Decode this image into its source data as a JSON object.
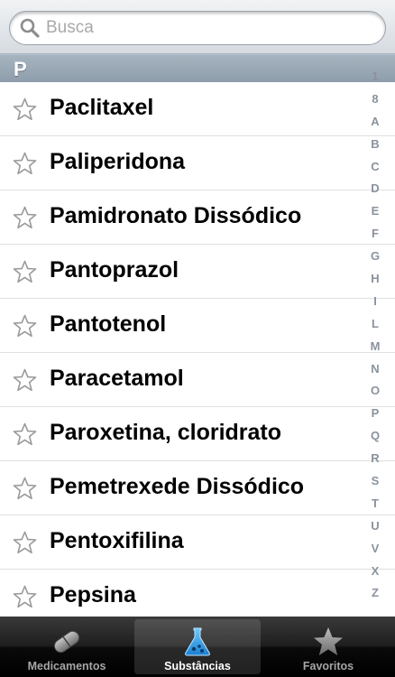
{
  "search": {
    "placeholder": "Busca",
    "icon": "search-icon"
  },
  "section": {
    "letter": "P"
  },
  "items": [
    {
      "label": "Paclitaxel",
      "icon": "star-outline-icon"
    },
    {
      "label": "Paliperidona",
      "icon": "star-outline-icon"
    },
    {
      "label": "Pamidronato Dissódico",
      "icon": "star-outline-icon"
    },
    {
      "label": "Pantoprazol",
      "icon": "star-outline-icon"
    },
    {
      "label": "Pantotenol",
      "icon": "star-outline-icon"
    },
    {
      "label": "Paracetamol",
      "icon": "star-outline-icon"
    },
    {
      "label": "Paroxetina, cloridrato",
      "icon": "star-outline-icon"
    },
    {
      "label": "Pemetrexede Dissódico",
      "icon": "star-outline-icon"
    },
    {
      "label": "Pentoxifilina",
      "icon": "star-outline-icon"
    },
    {
      "label": "Pepsina",
      "icon": "star-outline-icon"
    }
  ],
  "index": [
    "1",
    "8",
    "A",
    "B",
    "C",
    "D",
    "E",
    "F",
    "G",
    "H",
    "I",
    "L",
    "M",
    "N",
    "O",
    "P",
    "Q",
    "R",
    "S",
    "T",
    "U",
    "V",
    "X",
    "Z"
  ],
  "tabs": [
    {
      "label": "Medicamentos",
      "icon": "pill-icon",
      "selected": false
    },
    {
      "label": "Substâncias",
      "icon": "flask-icon",
      "selected": true
    },
    {
      "label": "Favoritos",
      "icon": "star-icon",
      "selected": false
    }
  ],
  "colors": {
    "tab_active_icon": "#2f9fe6",
    "index_text": "#8a929c",
    "section_header": "#97a5b2"
  }
}
